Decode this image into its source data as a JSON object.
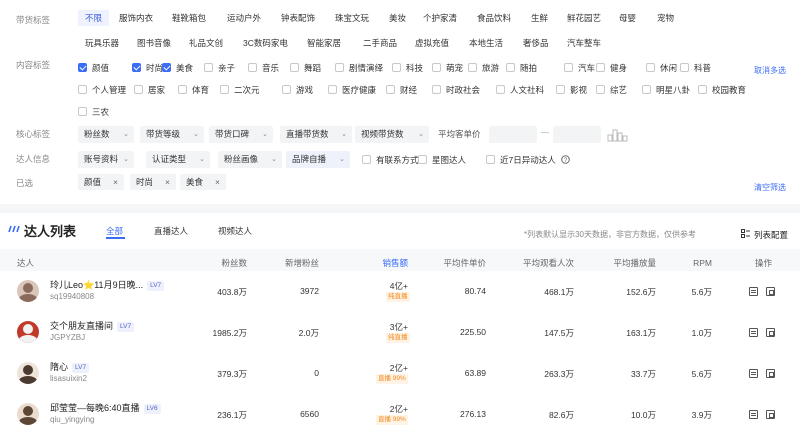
{
  "filters": {
    "goods_label": "带货标签",
    "goods_tags": [
      "不限",
      "服饰内衣",
      "鞋靴箱包",
      "运动户外",
      "钟表配饰",
      "珠宝文玩",
      "美妆",
      "个护家清",
      "食品饮料",
      "生鲜",
      "鲜花园艺",
      "母婴",
      "宠物",
      "玩具乐器",
      "图书音像",
      "礼品文创",
      "3C数码家电",
      "智能家居",
      "二手商品",
      "虚拟充值",
      "本地生活",
      "奢侈品",
      "汽车整车"
    ],
    "content_label": "内容标签",
    "content_tags": [
      {
        "t": "颜值",
        "on": true
      },
      {
        "t": "时尚",
        "on": true
      },
      {
        "t": "美食",
        "on": true
      },
      {
        "t": "亲子",
        "on": false
      },
      {
        "t": "音乐",
        "on": false
      },
      {
        "t": "舞蹈",
        "on": false
      },
      {
        "t": "剧情演绎",
        "on": false
      },
      {
        "t": "科技",
        "on": false
      },
      {
        "t": "萌宠",
        "on": false
      },
      {
        "t": "旅游",
        "on": false
      },
      {
        "t": "随拍",
        "on": false
      },
      {
        "t": "汽车",
        "on": false
      },
      {
        "t": "健身",
        "on": false
      },
      {
        "t": "休闲",
        "on": false
      },
      {
        "t": "科普",
        "on": false
      },
      {
        "t": "个人管理",
        "on": false
      },
      {
        "t": "居家",
        "on": false
      },
      {
        "t": "体育",
        "on": false
      },
      {
        "t": "二次元",
        "on": false
      },
      {
        "t": "游戏",
        "on": false
      },
      {
        "t": "医疗健康",
        "on": false
      },
      {
        "t": "财经",
        "on": false
      },
      {
        "t": "时政社会",
        "on": false
      },
      {
        "t": "人文社科",
        "on": false
      },
      {
        "t": "影视",
        "on": false
      },
      {
        "t": "综艺",
        "on": false
      },
      {
        "t": "明星八卦",
        "on": false
      },
      {
        "t": "校园教育",
        "on": false
      },
      {
        "t": "三农",
        "on": false
      }
    ],
    "cancel_multi": "取消多选",
    "core_label": "核心标签",
    "core_dropdowns": [
      "粉丝数",
      "带货等级",
      "带货口碑",
      "直播带货数",
      "视频带货数"
    ],
    "avg_price": "平均客单价",
    "range_sep": "—",
    "talent_label": "达人信息",
    "talent_dropdowns": [
      "账号资料",
      "认证类型",
      "粉丝画像",
      "品牌自播"
    ],
    "talent_checks": [
      "有联系方式",
      "星图达人",
      "近7日异动达人"
    ],
    "selected_label": "已选",
    "selected_tags": [
      "颜值",
      "时尚",
      "美食"
    ],
    "remove_icon": "×",
    "clear_filters": "清空筛选"
  },
  "list": {
    "title": "达人列表",
    "tabs": [
      "全部",
      "直播达人",
      "视频达人"
    ],
    "note": "*列表默认显示30天数据，非官方数据，仅供参考",
    "config": "列表配置",
    "headers": [
      "达人",
      "粉丝数",
      "新增粉丝",
      "销售额",
      "平均件单价",
      "平均观看人次",
      "平均播放量",
      "RPM",
      "操作"
    ],
    "rows": [
      {
        "name": "玲儿Leo⭐11月9日晚...",
        "id": "sq19940808",
        "lv": "LV7",
        "fans": "403.8万",
        "new_fans": "3972",
        "sales": "4亿+",
        "badge": "纯直播",
        "price": "80.74",
        "views": "468.1万",
        "plays": "152.6万",
        "rpm": "5.6万"
      },
      {
        "name": "交个朋友直播间",
        "id": "JGPYZBJ",
        "lv": "LV7",
        "fans": "1985.2万",
        "new_fans": "2.0万",
        "sales": "3亿+",
        "badge": "纯直播",
        "price": "225.50",
        "views": "147.5万",
        "plays": "163.1万",
        "rpm": "1.0万"
      },
      {
        "name": "隋心",
        "id": "lisasuixin2",
        "lv": "LV7",
        "fans": "379.3万",
        "new_fans": "0",
        "sales": "2亿+",
        "badge": "直播 99%",
        "price": "63.89",
        "views": "263.3万",
        "plays": "33.7万",
        "rpm": "5.6万"
      },
      {
        "name": "邱莹莹—每晚6:40直播",
        "id": "qiu_yingying",
        "lv": "LV6",
        "fans": "236.1万",
        "new_fans": "6560",
        "sales": "2亿+",
        "badge": "直播 99%",
        "price": "276.13",
        "views": "82.6万",
        "plays": "10.0万",
        "rpm": "3.9万"
      }
    ]
  }
}
